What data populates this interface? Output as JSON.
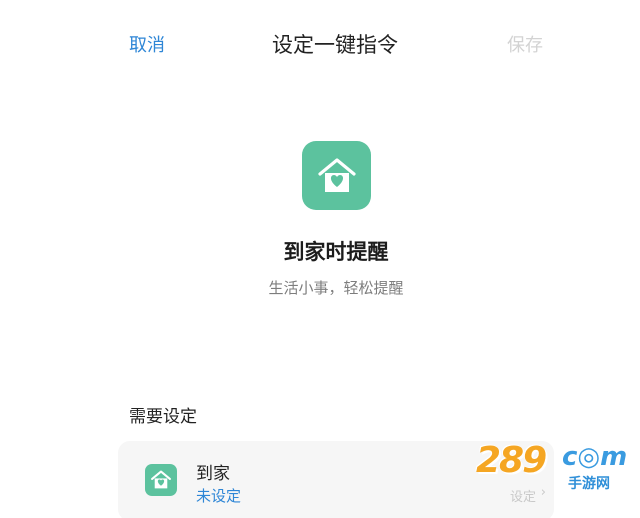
{
  "nav": {
    "cancel_label": "取消",
    "title": "设定一键指令",
    "save_label": "保存"
  },
  "hero": {
    "icon": "home-heart-icon",
    "title": "到家时提醒",
    "subtitle": "生活小事，轻松提醒"
  },
  "section": {
    "label": "需要设定"
  },
  "card": {
    "icon": "home-heart-icon",
    "title": "到家",
    "status": "未设定",
    "action_label": "设定",
    "chevron": "›"
  },
  "watermark": {
    "numeral": "289",
    "com": "c◎m",
    "sub": "手游网"
  },
  "colors": {
    "accent_blue": "#2e86d6",
    "icon_green": "#5cc29e",
    "disabled_gray": "#d3d3d3",
    "card_bg": "#f6f6f6"
  }
}
